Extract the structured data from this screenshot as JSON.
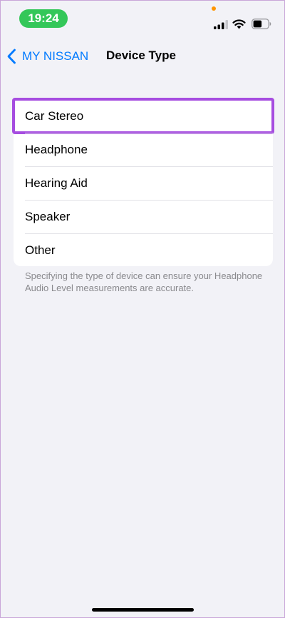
{
  "status_bar": {
    "time": "19:24",
    "icons": [
      "signal-icon",
      "wifi-icon",
      "battery-icon"
    ],
    "colors": {
      "time_pill": "#34c759",
      "privacy_dot": "#ff9500"
    }
  },
  "nav": {
    "back_label": "MY NISSAN",
    "back_icon": "chevron-left-icon",
    "title": "Device Type"
  },
  "device_types": [
    {
      "label": "Car Stereo",
      "selected": true
    },
    {
      "label": "Headphone",
      "selected": false
    },
    {
      "label": "Hearing Aid",
      "selected": false
    },
    {
      "label": "Speaker",
      "selected": false
    },
    {
      "label": "Other",
      "selected": false
    }
  ],
  "footer_note": "Specifying the type of device can ensure your Headphone Audio Level measurements are accurate.",
  "colors": {
    "accent": "#007aff",
    "highlight": "#a64de0",
    "background": "#f2f2f7"
  }
}
